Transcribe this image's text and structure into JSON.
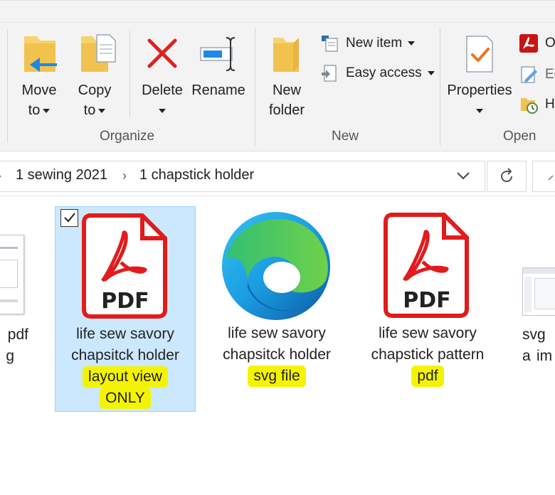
{
  "ribbon": {
    "organize": {
      "label": "Organize",
      "move_to": {
        "line1": "Move",
        "line2": "to"
      },
      "copy_to": {
        "line1": "Copy",
        "line2": "to"
      },
      "delete": "Delete",
      "rename": "Rename"
    },
    "new": {
      "label": "New",
      "new_folder": {
        "line1": "New",
        "line2": "folder"
      },
      "new_item": "New item",
      "easy_access": "Easy access"
    },
    "open": {
      "label": "Open",
      "properties": "Properties",
      "open_partial": "O",
      "edit_partial": "Ec",
      "history_partial": "H"
    }
  },
  "address": {
    "crumbs": [
      "1 sewing 2021",
      "1 chapstick holder"
    ]
  },
  "files": [
    {
      "line1": "pdf",
      "line2": "g"
    },
    {
      "line1": "life sew savory",
      "line2": "chapsitck holder",
      "line3": "layout view",
      "line4": "ONLY",
      "type": "pdf-icon"
    },
    {
      "line1": "life sew savory",
      "line2": "chapsitck holder",
      "line3": "svg file",
      "type": "edge-icon"
    },
    {
      "line1": "life sew savory",
      "line2": "chapstick pattern",
      "line3": "pdf",
      "type": "pdf-icon"
    },
    {
      "line1": "svg a",
      "line2": "im"
    }
  ],
  "pdf_badge": "PDF",
  "colors": {
    "selection": "#cce8ff",
    "highlight": "#f4f400",
    "pdf_red": "#e21b1b",
    "delete_red": "#e02020",
    "folder_yellow": "#f7d36b",
    "move_blue": "#1e88e5"
  }
}
